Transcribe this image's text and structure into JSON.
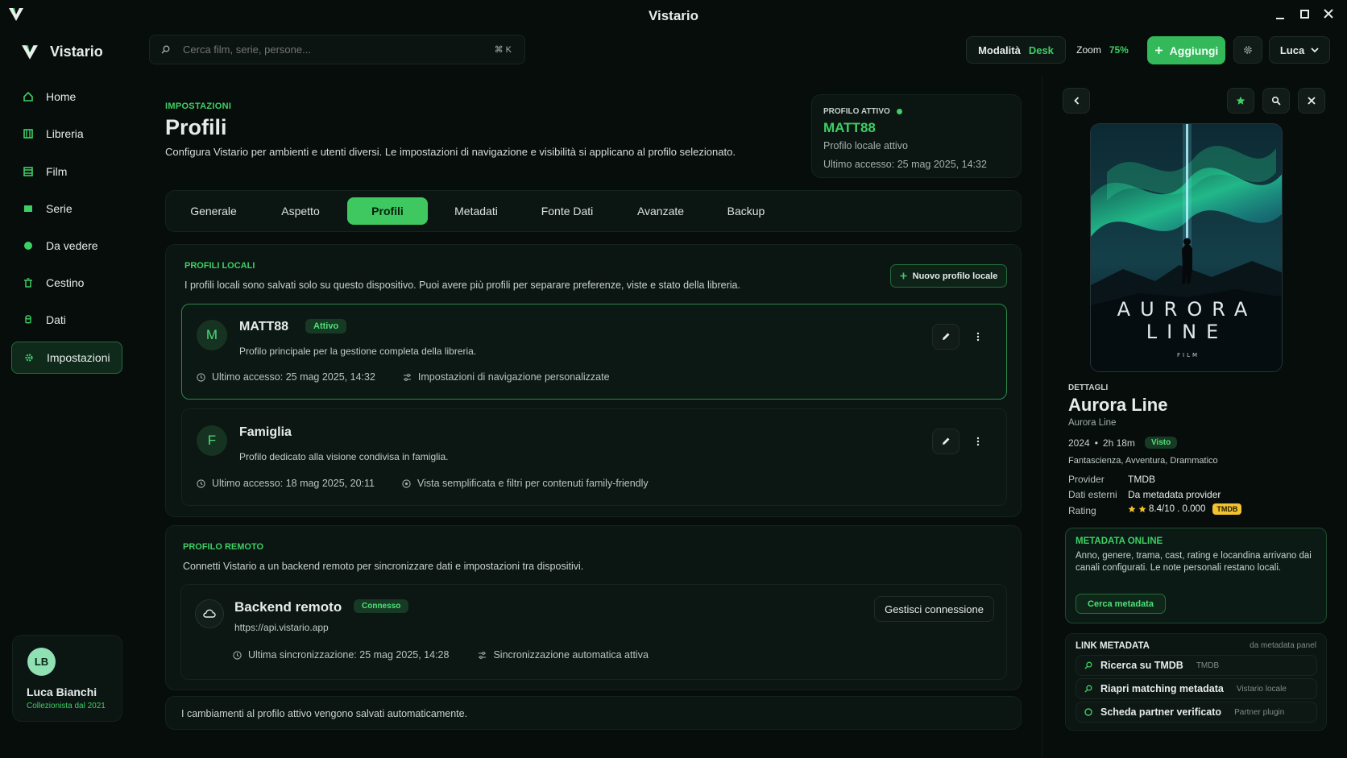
{
  "window": {
    "title": "Vistario"
  },
  "sidebar": {
    "app_name": "Vistario",
    "items": [
      {
        "label": "Home",
        "icon": "home-icon"
      },
      {
        "label": "Libreria",
        "icon": "library-icon"
      },
      {
        "label": "Film",
        "icon": "film-icon"
      },
      {
        "label": "Serie",
        "icon": "tv-icon"
      },
      {
        "label": "Da vedere",
        "icon": "watchlist-icon"
      },
      {
        "label": "Cestino",
        "icon": "trash-icon"
      },
      {
        "label": "Dati",
        "icon": "database-icon"
      },
      {
        "label": "Impostazioni",
        "icon": "gear-icon",
        "active": true
      }
    ],
    "user": {
      "initials": "LB",
      "name": "Luca Bianchi",
      "subtitle": "Collezionista dal 2021"
    }
  },
  "topbar": {
    "search_placeholder": "Cerca film, serie, persone...",
    "shortcut": "⌘ K",
    "mode_label": "Modalità",
    "mode_value": "Desk",
    "zoom_label": "Zoom",
    "zoom_value": "75%",
    "add_label": "Aggiungi",
    "user_menu": "Luca"
  },
  "page": {
    "eyebrow": "IMPOSTAZIONI",
    "title": "Profili",
    "description": "Configura Vistario per ambienti e utenti diversi. Le impostazioni di navigazione e visibilità si applicano al profilo selezionato."
  },
  "active_profile": {
    "label": "PROFILO ATTIVO",
    "name": "MATT88",
    "type": "Profilo locale attivo",
    "last_access": "Ultimo accesso: 25 mag 2025, 14:32"
  },
  "tabs": [
    {
      "label": "Generale"
    },
    {
      "label": "Aspetto"
    },
    {
      "label": "Profili",
      "active": true
    },
    {
      "label": "Metadati"
    },
    {
      "label": "Fonte Dati"
    },
    {
      "label": "Avanzate"
    },
    {
      "label": "Backup"
    }
  ],
  "local_profiles": {
    "title": "PROFILI LOCALI",
    "description": "I profili locali sono salvati solo su questo dispositivo. Puoi avere più profili per separare preferenze, viste e stato della libreria.",
    "new_button": "Nuovo profilo locale",
    "profiles": [
      {
        "initial": "M",
        "name": "MATT88",
        "badge": "Attivo",
        "description": "Profilo principale per la gestione completa della libreria.",
        "last_access": "Ultimo accesso: 25 mag 2025, 14:32",
        "detail": "Impostazioni di navigazione personalizzate"
      },
      {
        "initial": "F",
        "name": "Famiglia",
        "description": "Profilo dedicato alla visione condivisa in famiglia.",
        "last_access": "Ultimo accesso: 18 mag 2025, 20:11",
        "detail": "Vista semplificata e filtri per contenuti family-friendly"
      }
    ]
  },
  "remote_profile": {
    "title": "PROFILO REMOTO",
    "description": "Connetti Vistario a un backend remoto per sincronizzare dati e impostazioni tra dispositivi.",
    "name": "Backend remoto",
    "badge": "Connesso",
    "url": "https://api.vistario.app",
    "last_sync": "Ultima sincronizzazione: 25 mag 2025, 14:28",
    "sync_status": "Sincronizzazione automatica attiva",
    "manage_button": "Gestisci connessione"
  },
  "footer_note": "I cambiamenti al profilo attivo vengono salvati automaticamente.",
  "detail_panel": {
    "poster": {
      "title_line1": "AURORA",
      "title_line2": "LINE",
      "subtitle": "FILM"
    },
    "label": "DETTAGLI",
    "title": "Aurora Line",
    "original_title": "Aurora Line",
    "year": "2024",
    "runtime": "2h 18m",
    "status_badge": "Visto",
    "genres": "Fantascienza, Avventura, Drammatico",
    "rows": [
      {
        "key": "Provider",
        "value": "TMDB"
      },
      {
        "key": "Dati esterni",
        "value": "Da metadata provider"
      }
    ],
    "rating_key": "Rating",
    "rating_value": "8.4/10 . 0.000",
    "rating_source": "TMDB",
    "metadata_online": {
      "title": "METADATA ONLINE",
      "text": "Anno, genere, trama, cast, rating e locandina arrivano dai canali configurati. Le note personali restano locali.",
      "button": "Cerca metadata"
    },
    "link_metadata": {
      "title": "LINK METADATA",
      "source": "da metadata panel",
      "links": [
        {
          "label": "Ricerca su TMDB",
          "tag": "TMDB"
        },
        {
          "label": "Riapri matching metadata",
          "tag": "Vistario locale"
        },
        {
          "label": "Scheda partner verificato",
          "tag": "Partner plugin"
        }
      ]
    }
  },
  "colors": {
    "accent": "#3ecf64",
    "background": "#060d0b",
    "panel": "#0b1512"
  }
}
